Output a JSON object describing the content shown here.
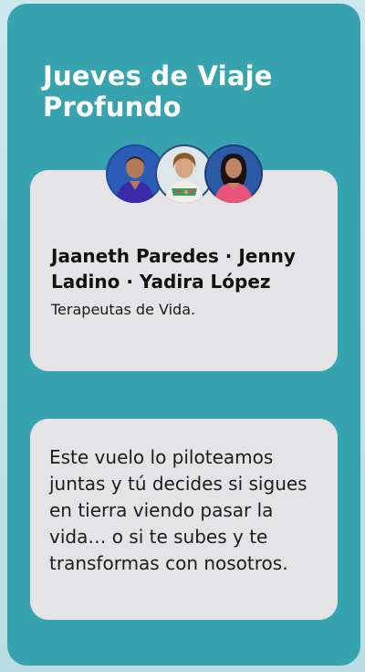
{
  "card": {
    "title": "Jueves de Viaje Profundo"
  },
  "people": {
    "avatars": [
      "avatar-jaaneth",
      "avatar-jenny",
      "avatar-yadira"
    ],
    "names": "Jaaneth Paredes · Jenny Ladino · Yadira López",
    "role": "Terapeutas de Vida."
  },
  "quote": {
    "text": "Este vuelo lo piloteamos juntas y tú decides si sigues en tierra viendo pasar la vida… o si te subes y te transformas con nosotros."
  },
  "colors": {
    "card_background": "#36a3ae",
    "panel_background": "#e4e4e6",
    "title_text": "#ffffff",
    "body_text": "#111111"
  }
}
